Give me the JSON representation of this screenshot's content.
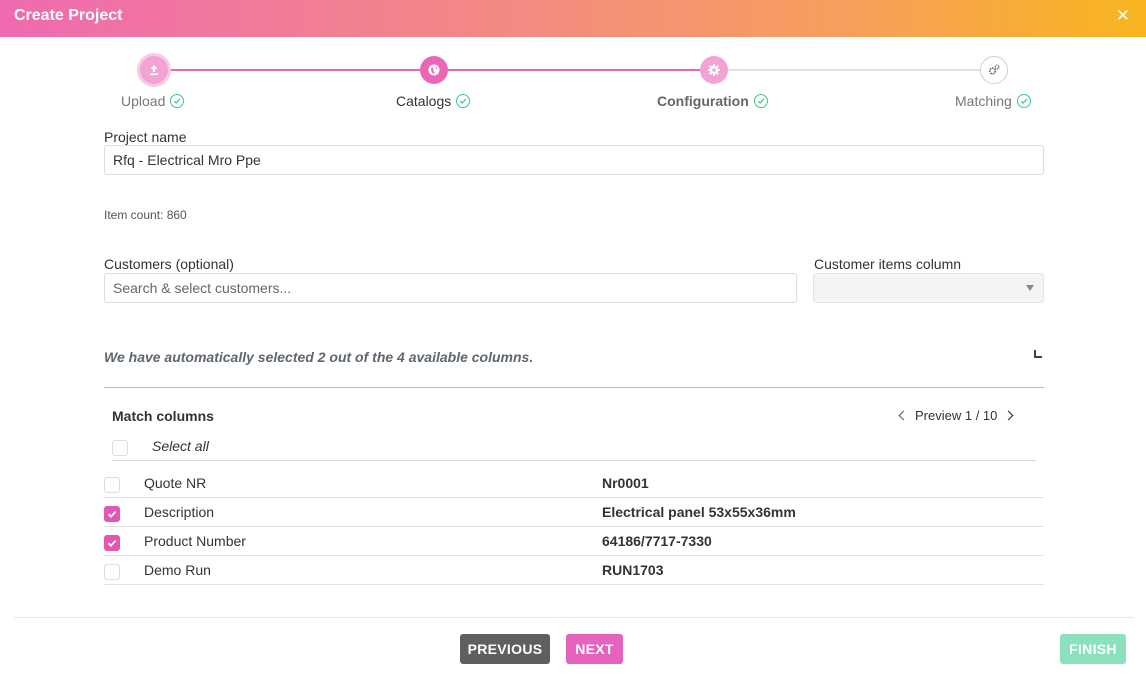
{
  "window": {
    "title": "Create Project"
  },
  "stepper": {
    "steps": [
      {
        "label": "Upload",
        "icon": "upload-icon",
        "state": "complete"
      },
      {
        "label": "Catalogs",
        "icon": "globe-icon",
        "state": "complete"
      },
      {
        "label": "Configuration",
        "icon": "gear-icon",
        "state": "active"
      },
      {
        "label": "Matching",
        "icon": "gears-icon",
        "state": "complete"
      }
    ]
  },
  "form": {
    "project_name_label": "Project name",
    "project_name_value": "Rfq - Electrical Mro Ppe",
    "item_count": "Item count: 860",
    "customers_label": "Customers (optional)",
    "customers_placeholder": "Search & select customers...",
    "customer_items_label": "Customer items column",
    "customer_items_value": ""
  },
  "auto_select_note": "We have automatically selected 2 out of the 4 available columns.",
  "match": {
    "title": "Match columns",
    "preview_label": "Preview 1 / 10",
    "select_all_label": "Select all",
    "rows": [
      {
        "name": "Quote NR",
        "value": "Nr0001",
        "checked": false
      },
      {
        "name": "Description",
        "value": "Electrical panel 53x55x36mm",
        "checked": true
      },
      {
        "name": "Product Number",
        "value": "64186/7717-7330",
        "checked": true
      },
      {
        "name": "Demo Run",
        "value": "RUN1703",
        "checked": false
      }
    ]
  },
  "footer": {
    "previous_label": "PREVIOUS",
    "next_label": "NEXT",
    "finish_label": "FINISH"
  },
  "colors": {
    "accent_pink": "#e563bc",
    "success_green": "#3cc98b",
    "finish_green": "#8be0bd"
  }
}
